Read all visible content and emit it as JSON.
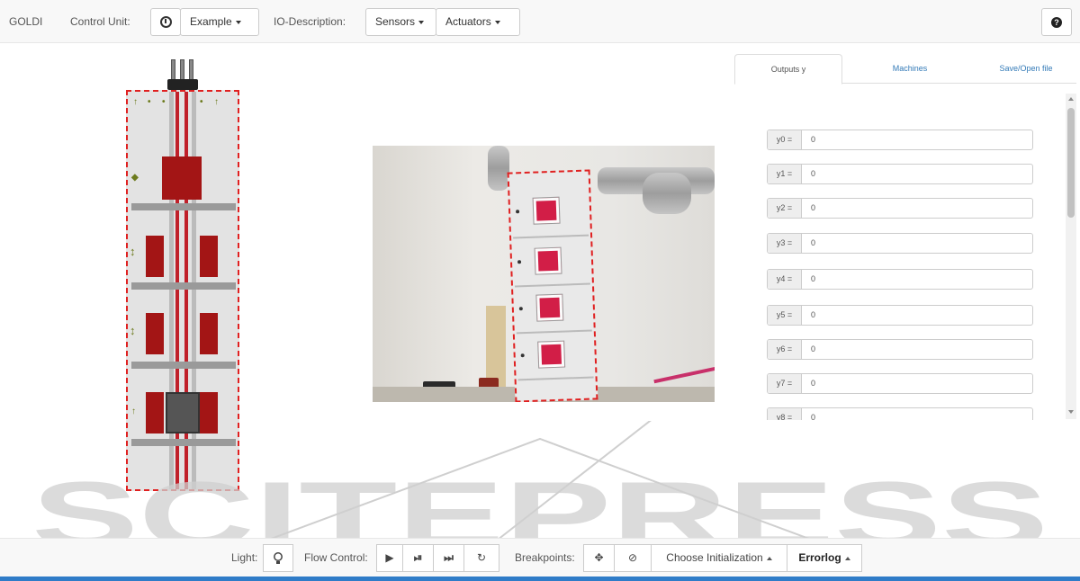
{
  "navbar": {
    "brand": "GOLDI",
    "control_unit_label": "Control Unit:",
    "control_unit_icon": "info-circle-icon",
    "example_label": "Example",
    "io_description_label": "IO-Description:",
    "sensors_label": "Sensors",
    "actuators_label": "Actuators",
    "help_icon": "question-circle-icon"
  },
  "tabs": [
    {
      "label": "Outputs y",
      "active": true
    },
    {
      "label": "Machines",
      "active": false
    },
    {
      "label": "Save/Open file",
      "active": false
    }
  ],
  "outputs": [
    {
      "label": "y0 =",
      "value": "0"
    },
    {
      "label": "y1 =",
      "value": "0"
    },
    {
      "label": "y2 =",
      "value": "0"
    },
    {
      "label": "y3 =",
      "value": "0"
    },
    {
      "label": "y4 =",
      "value": "0"
    },
    {
      "label": "y5 =",
      "value": "0"
    },
    {
      "label": "y6 =",
      "value": "0"
    },
    {
      "label": "y7 =",
      "value": "0"
    },
    {
      "label": "y8 =",
      "value": "0"
    }
  ],
  "bottombar": {
    "light_label": "Light:",
    "light_icon": "lightbulb-icon",
    "flow_control_label": "Flow Control:",
    "flow_icons": [
      "play-icon",
      "step-icon",
      "step-end-icon",
      "reset-icon"
    ],
    "breakpoints_label": "Breakpoints:",
    "breakpoint_icons": [
      "crosshair-icon",
      "clock-icon"
    ],
    "choose_init_label": "Choose Initialization",
    "errorlog_label": "Errorlog"
  },
  "watermark": {
    "text": "SCITEPRESS"
  },
  "colors": {
    "accent": "#337ab7",
    "elevator_red": "#a31515",
    "dashed_outline": "#e02020",
    "status_bar": "#2f7cc8"
  }
}
